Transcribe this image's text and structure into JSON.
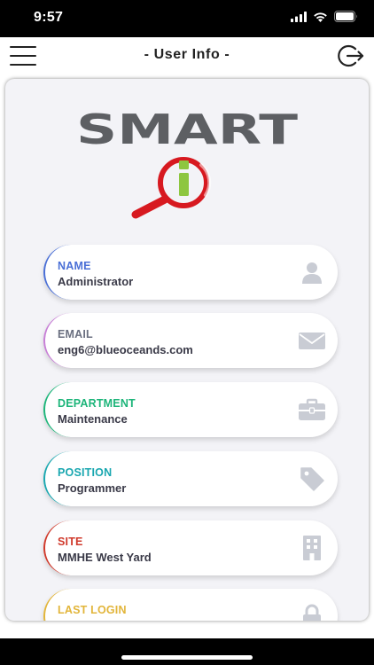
{
  "status_bar": {
    "time": "9:57"
  },
  "nav": {
    "title": "- User Info -"
  },
  "logo": {
    "word": "SMART",
    "i_letter": "i"
  },
  "fields": [
    {
      "label": "NAME",
      "value": "Administrator",
      "color": "#4a6fd6",
      "icon": "person-icon"
    },
    {
      "label": "EMAIL",
      "value": "eng6@blueoceands.com",
      "color": "#c77fd6",
      "icon": "envelope-icon"
    },
    {
      "label": "DEPARTMENT",
      "value": "Maintenance",
      "color": "#1db57a",
      "icon": "briefcase-icon"
    },
    {
      "label": "POSITION",
      "value": "Programmer",
      "color": "#1aa7b0",
      "icon": "tag-icon"
    },
    {
      "label": "SITE",
      "value": "MMHE West Yard",
      "color": "#d0392b",
      "icon": "building-icon"
    },
    {
      "label": "LAST LOGIN",
      "value": "",
      "color": "#e2b53a",
      "icon": "lock-icon"
    }
  ],
  "colors": {
    "icon_gray": "#c9ccd4",
    "logo_gray": "#5d5f63",
    "logo_red": "#d71920",
    "logo_green": "#8dc63f"
  }
}
